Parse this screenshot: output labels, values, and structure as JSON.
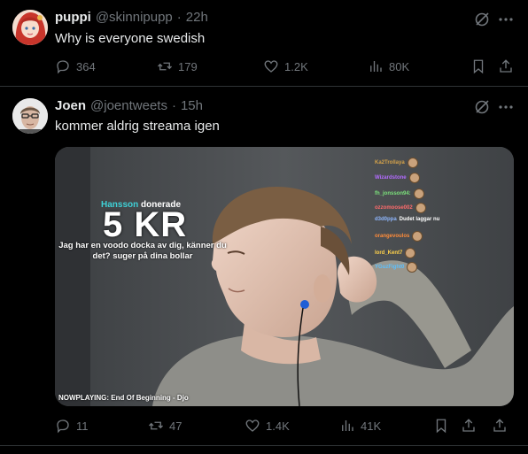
{
  "tweet1": {
    "name": "puppi",
    "handle": "@skinnipupp",
    "time": "22h",
    "text": "Why is everyone swedish",
    "replies": "364",
    "reposts": "179",
    "likes": "1.2K",
    "views": "80K"
  },
  "tweet2": {
    "name": "Joen",
    "handle": "@joentweets",
    "time": "15h",
    "text": "kommer aldrig streama igen",
    "replies": "11",
    "reposts": "47",
    "likes": "1.4K",
    "views": "41K"
  },
  "media": {
    "donor_name": "Hansson",
    "donor_verb": "donerade",
    "amount": "5 KR",
    "message": "Jag har en voodo docka av dig, känner du det? suger på dina bollar",
    "nowplaying": "NOWPLAYING: End Of Beginning - Djo",
    "chat": [
      {
        "user": "Ka2Trollaya",
        "color": "#d4a24a"
      },
      {
        "user": "Wizardstone",
        "color": "#b36bff"
      },
      {
        "user": "fh_jonsson94:",
        "color": "#7be07b"
      },
      {
        "user": "ozzomoose002",
        "color": "#ff6b6b"
      },
      {
        "user": "d3d0ppa",
        "text": "Dudet laggar nu",
        "color": "#8fb7ff"
      },
      {
        "user": "orangevoulos",
        "color": "#ff8c3a"
      },
      {
        "user": "lord_Kent7",
        "color": "#ffd24a"
      },
      {
        "user": "YGuzFight0",
        "color": "#5bc0ff"
      }
    ]
  },
  "dot": "·",
  "colors": {
    "accent": "#1d9bf0",
    "muted": "#71767b",
    "text": "#e7e9ea",
    "divider": "#2f3336"
  }
}
